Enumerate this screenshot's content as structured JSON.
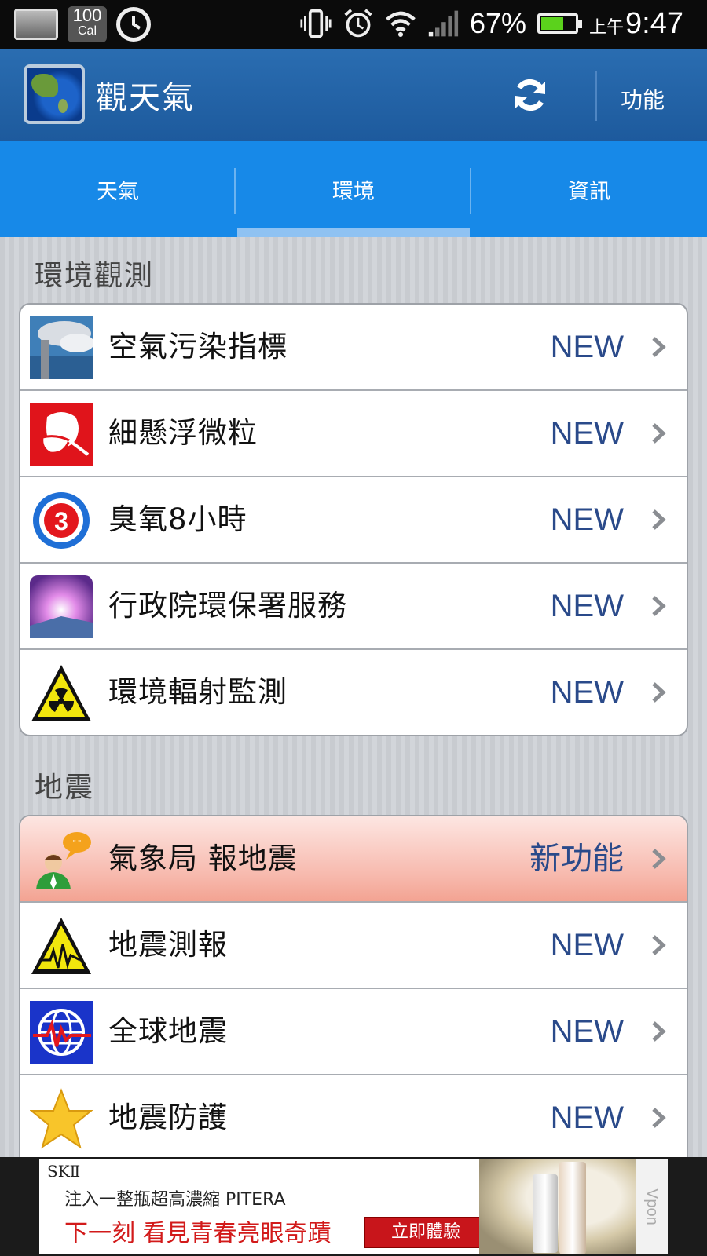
{
  "status_bar": {
    "calorie_value": "100",
    "calorie_unit": "Cal",
    "battery_percent": "67%",
    "battery_level": 0.67,
    "time_period": "上午",
    "time": "9:47"
  },
  "app": {
    "title": "觀天氣",
    "function_label": "功能"
  },
  "tabs": [
    {
      "label": "天氣",
      "active": false
    },
    {
      "label": "環境",
      "active": true
    },
    {
      "label": "資訊",
      "active": false
    }
  ],
  "sections": [
    {
      "title": "環境觀測",
      "items": [
        {
          "label": "空氣污染指標",
          "badge": "NEW",
          "icon": "smokestack-icon"
        },
        {
          "label": "細懸浮微粒",
          "badge": "NEW",
          "icon": "mask-icon"
        },
        {
          "label": "臭氧8小時",
          "badge": "NEW",
          "icon": "ozone-3-icon"
        },
        {
          "label": "行政院環保署服務",
          "badge": "NEW",
          "icon": "epa-sky-icon"
        },
        {
          "label": "環境輻射監測",
          "badge": "NEW",
          "icon": "radiation-icon"
        }
      ]
    },
    {
      "title": "地震",
      "items": [
        {
          "label": "氣象局 報地震",
          "badge": "新功能",
          "icon": "user-chat-icon",
          "highlighted": true
        },
        {
          "label": "地震測報",
          "badge": "NEW",
          "icon": "seismic-warning-icon"
        },
        {
          "label": "全球地震",
          "badge": "NEW",
          "icon": "globe-quake-icon"
        },
        {
          "label": "地震防護",
          "badge": "NEW",
          "icon": "star-icon"
        }
      ]
    }
  ],
  "ad": {
    "brand": "SKⅡ",
    "line1": "注入一整瓶超高濃縮 PITERA",
    "line2": "下一刻 看見青春亮眼奇蹟",
    "cta": "立即體驗",
    "side_label": "Vpon"
  },
  "colors": {
    "action_bar": "#1d5a9d",
    "tab_bar": "#1789e8",
    "badge": "#2a4a8a",
    "highlight_row": "#f7b9ad"
  }
}
